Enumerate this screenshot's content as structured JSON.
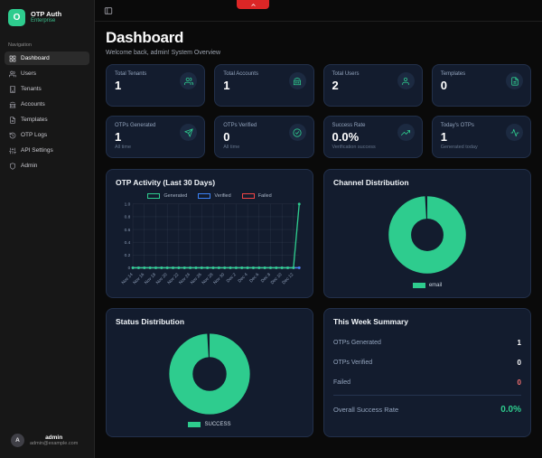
{
  "app": {
    "name": "OTP Auth",
    "edition": "Enterprise",
    "logo_letter": "O"
  },
  "colors": {
    "accent_green": "#2ecc8e",
    "blue": "#3b82f6",
    "red": "#ef4444",
    "failed_text": "#f87171",
    "card_bg": "#131c2e",
    "sidebar_bg": "#171717"
  },
  "sidebar": {
    "section_label": "Navigation",
    "items": [
      {
        "label": "Dashboard",
        "icon": "dashboard-grid-icon",
        "active": true
      },
      {
        "label": "Users",
        "icon": "users-icon",
        "active": false
      },
      {
        "label": "Tenants",
        "icon": "building-icon",
        "active": false
      },
      {
        "label": "Accounts",
        "icon": "bank-icon",
        "active": false
      },
      {
        "label": "Templates",
        "icon": "file-text-icon",
        "active": false
      },
      {
        "label": "OTP Logs",
        "icon": "history-clock-icon",
        "active": false
      },
      {
        "label": "API Settings",
        "icon": "sliders-icon",
        "active": false
      },
      {
        "label": "Admin",
        "icon": "shield-icon",
        "active": false
      }
    ],
    "user": {
      "avatar_letter": "A",
      "name": "admin",
      "email": "admin@example.com"
    }
  },
  "header": {
    "title": "Dashboard",
    "subtitle": "Welcome back, admin! System Overview"
  },
  "stats": [
    {
      "label": "Total Tenants",
      "value": "1",
      "sub": "",
      "icon": "people-group-icon"
    },
    {
      "label": "Total Accounts",
      "value": "1",
      "sub": "",
      "icon": "bank-icon"
    },
    {
      "label": "Total Users",
      "value": "2",
      "sub": "",
      "icon": "person-icon"
    },
    {
      "label": "Templates",
      "value": "0",
      "sub": "",
      "icon": "file-text-icon"
    },
    {
      "label": "OTPs Generated",
      "value": "1",
      "sub": "All time",
      "icon": "send-icon"
    },
    {
      "label": "OTPs Verified",
      "value": "0",
      "sub": "All time",
      "icon": "check-circle-icon"
    },
    {
      "label": "Success Rate",
      "value": "0.0%",
      "sub": "Verification success",
      "icon": "trending-up-icon"
    },
    {
      "label": "Today's OTPs",
      "value": "1",
      "sub": "Generated today",
      "icon": "activity-pulse-icon"
    }
  ],
  "chart_data": [
    {
      "type": "line",
      "title": "OTP Activity (Last 30 Days)",
      "x": [
        "Nov 14",
        "Nov 15",
        "Nov 16",
        "Nov 17",
        "Nov 18",
        "Nov 19",
        "Nov 20",
        "Nov 21",
        "Nov 22",
        "Nov 23",
        "Nov 24",
        "Nov 25",
        "Nov 26",
        "Nov 27",
        "Nov 28",
        "Nov 29",
        "Nov 30",
        "Dec 1",
        "Dec 2",
        "Dec 3",
        "Dec 4",
        "Dec 5",
        "Dec 6",
        "Dec 7",
        "Dec 8",
        "Dec 9",
        "Dec 10",
        "Dec 11",
        "Dec 12",
        "Dec 13"
      ],
      "x_tick_every": 2,
      "series": [
        {
          "name": "Generated",
          "color": "#2ecc8e",
          "values": [
            0,
            0,
            0,
            0,
            0,
            0,
            0,
            0,
            0,
            0,
            0,
            0,
            0,
            0,
            0,
            0,
            0,
            0,
            0,
            0,
            0,
            0,
            0,
            0,
            0,
            0,
            0,
            0,
            0,
            1
          ]
        },
        {
          "name": "Verified",
          "color": "#3b82f6",
          "values": [
            0,
            0,
            0,
            0,
            0,
            0,
            0,
            0,
            0,
            0,
            0,
            0,
            0,
            0,
            0,
            0,
            0,
            0,
            0,
            0,
            0,
            0,
            0,
            0,
            0,
            0,
            0,
            0,
            0,
            0
          ]
        },
        {
          "name": "Failed",
          "color": "#ef4444",
          "values": [
            0,
            0,
            0,
            0,
            0,
            0,
            0,
            0,
            0,
            0,
            0,
            0,
            0,
            0,
            0,
            0,
            0,
            0,
            0,
            0,
            0,
            0,
            0,
            0,
            0,
            0,
            0,
            0,
            0,
            0
          ]
        }
      ],
      "ylim": [
        0,
        1.0
      ],
      "yticks": [
        0,
        0.2,
        0.4,
        0.6,
        0.8,
        1.0
      ],
      "grid": true,
      "legend_position": "top"
    },
    {
      "type": "pie",
      "variant": "donut",
      "title": "Channel Distribution",
      "labels": [
        "email"
      ],
      "values": [
        1
      ],
      "colors": [
        "#2ecc8e"
      ],
      "legend_position": "bottom"
    },
    {
      "type": "pie",
      "variant": "donut",
      "title": "Status Distribution",
      "labels": [
        "SUCCESS"
      ],
      "values": [
        1
      ],
      "colors": [
        "#2ecc8e"
      ],
      "legend_position": "bottom"
    }
  ],
  "summary": {
    "title": "This Week Summary",
    "rows": [
      {
        "label": "OTPs Generated",
        "value": "1",
        "color": "#ffffff"
      },
      {
        "label": "OTPs Verified",
        "value": "0",
        "color": "#ffffff"
      },
      {
        "label": "Failed",
        "value": "0",
        "color": "#f87171"
      }
    ],
    "footer": {
      "label": "Overall Success Rate",
      "value": "0.0%",
      "color": "#2ecc8e"
    }
  },
  "dev_tab": {
    "icon": "chevron-up-icon"
  }
}
